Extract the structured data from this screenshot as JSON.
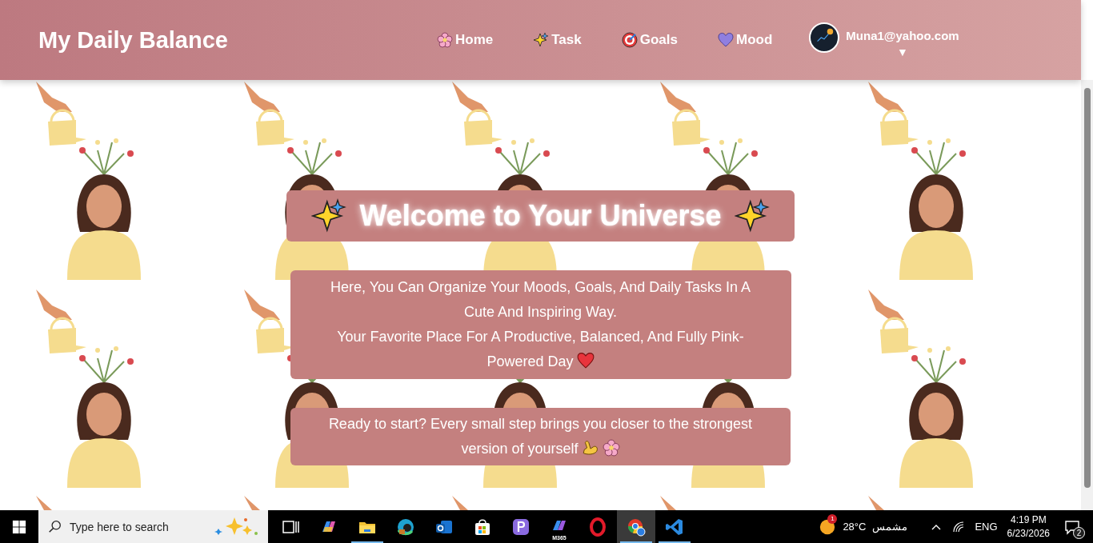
{
  "header": {
    "brand": "My Daily Balance",
    "nav": [
      {
        "label": "Home"
      },
      {
        "label": "Task"
      },
      {
        "label": "Goals"
      },
      {
        "label": "Mood"
      }
    ],
    "user": {
      "email": "Muna1@yahoo.com",
      "caret": "▼"
    }
  },
  "hero": {
    "title": "Welcome to Your Universe",
    "intro": [
      "Here, You Can Organize Your Moods, Goals, And Daily Tasks In A Cute And Inspiring Way.",
      "Your Favorite Place For A Productive, Balanced, And Fully Pink-Powered Day"
    ],
    "cta": "Ready to start? Every small step brings you closer to the strongest version of yourself"
  },
  "taskbar": {
    "search": {
      "placeholder": "Type here to search"
    },
    "apps": [
      {
        "kind": "taskview",
        "running": false,
        "selected": false
      },
      {
        "kind": "copilot",
        "running": false,
        "selected": false
      },
      {
        "kind": "explorer",
        "running": true,
        "selected": false
      },
      {
        "kind": "edge",
        "running": false,
        "selected": false
      },
      {
        "kind": "outlook",
        "running": false,
        "selected": false
      },
      {
        "kind": "store",
        "running": false,
        "selected": false
      },
      {
        "kind": "papp",
        "running": false,
        "selected": false
      },
      {
        "kind": "m365",
        "label": "M365",
        "running": false,
        "selected": false
      },
      {
        "kind": "opera",
        "running": false,
        "selected": false
      },
      {
        "kind": "chrome",
        "running": true,
        "selected": true
      },
      {
        "kind": "vscode",
        "running": true,
        "selected": false
      }
    ],
    "weather": {
      "badge": "1",
      "temperature": "28°C",
      "condition": "مشمس"
    },
    "language": "ENG",
    "time": "4:19 PM",
    "date": "6/23/2026",
    "notifications": "2"
  }
}
